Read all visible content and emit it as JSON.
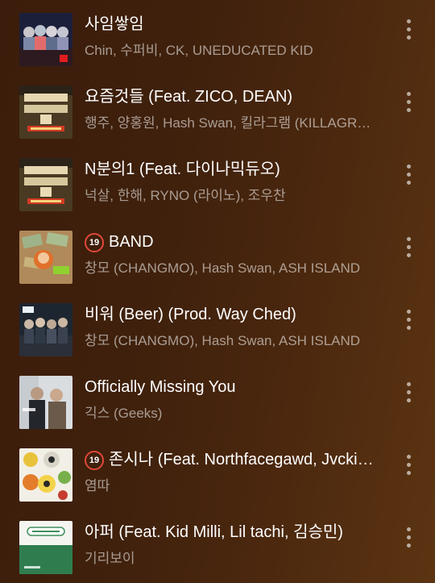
{
  "tracks": [
    {
      "title": "사임쌓임",
      "artist": "Chin, 수퍼비, CK, UNEDUCATED KID",
      "explicit": false,
      "art": "album-art-group-photo"
    },
    {
      "title": "요즘것들 (Feat. ZICO, DEAN)",
      "artist": "행주, 양홍원, Hash Swan, 킬라그램 (KILLAGRAMZ)",
      "explicit": false,
      "art": "album-art-show-me-the-money-6-episode-1"
    },
    {
      "title": "N분의1 (Feat. 다이나믹듀오)",
      "artist": "넉살, 한해, RYNO (라이노), 조우찬",
      "explicit": false,
      "art": "album-art-show-me-the-money-6-episode-1"
    },
    {
      "title": "BAND",
      "artist": "창모 (CHANGMO), Hash Swan, ASH ISLAND",
      "explicit": true,
      "explicit_label": "19",
      "art": "album-art-band"
    },
    {
      "title": "비워 (Beer) (Prod. Way Ched)",
      "artist": "창모 (CHANGMO), Hash Swan, ASH ISLAND",
      "explicit": false,
      "art": "album-art-group-photo"
    },
    {
      "title": "Officially Missing You",
      "artist": "긱스 (Geeks)",
      "explicit": false,
      "art": "album-art-geeks"
    },
    {
      "title": "존시나 (Feat. Northfacegawd, Jvcki Wai)",
      "artist": "염따",
      "explicit": true,
      "explicit_label": "19",
      "art": "album-art-cartoon"
    },
    {
      "title": "아퍼 (Feat. Kid Milli, Lil tachi, 김승민)",
      "artist": "기리보이",
      "explicit": false,
      "art": "album-art-green"
    }
  ],
  "colors": {
    "background": "#3e200c",
    "title": "#ffffff",
    "subtitle": "rgba(255,255,255,0.55)",
    "explicit_badge": "#e0483a",
    "more_icon": "rgba(255,255,255,0.6)"
  },
  "icons": {
    "more": "more-vertical-icon",
    "explicit": "explicit-19-badge-icon"
  }
}
